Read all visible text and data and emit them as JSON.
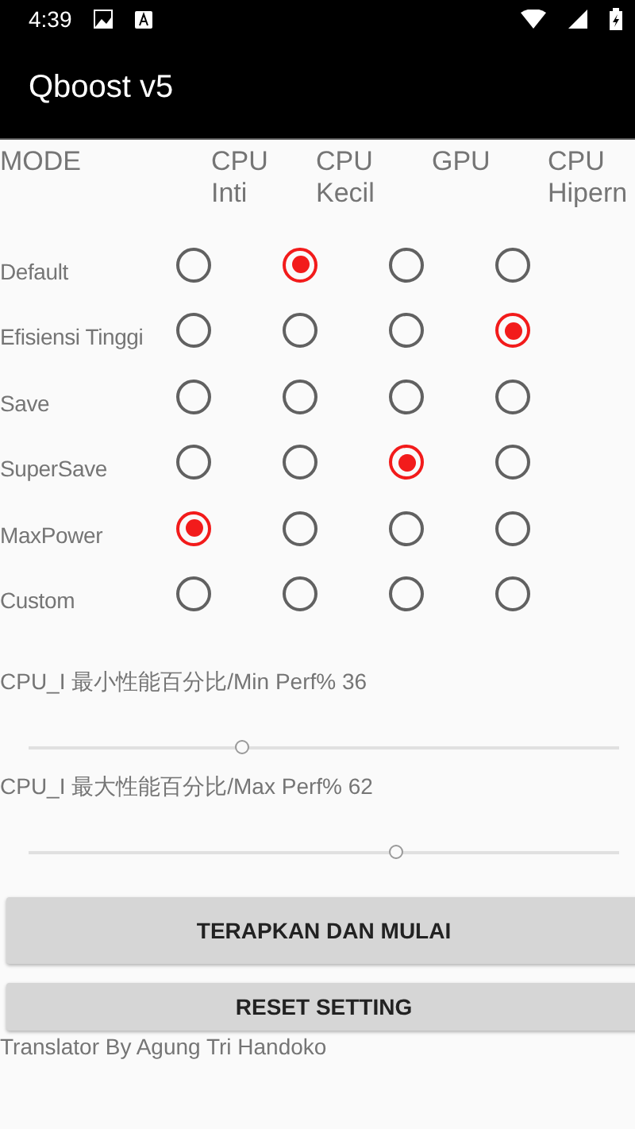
{
  "status_bar": {
    "time": "4:39"
  },
  "app_bar": {
    "title": "Qboost v5"
  },
  "table": {
    "mode_header": "MODE",
    "columns": [
      "CPU Inti",
      "CPU Kecil",
      "GPU",
      "CPU Hipern"
    ],
    "rows": [
      {
        "label": "Default",
        "options": [
          {
            "selected": false
          },
          {
            "selected": true
          },
          {
            "selected": false
          },
          {
            "selected": false
          }
        ]
      },
      {
        "label": "Efisiensi Tinggi",
        "options": [
          {
            "selected": false
          },
          {
            "selected": false
          },
          {
            "selected": false
          },
          {
            "selected": true
          }
        ]
      },
      {
        "label": "Save",
        "options": [
          {
            "selected": false
          },
          {
            "selected": false
          },
          {
            "selected": false
          },
          {
            "selected": false
          }
        ]
      },
      {
        "label": "SuperSave",
        "options": [
          {
            "selected": false
          },
          {
            "selected": false
          },
          {
            "selected": true
          },
          {
            "selected": false
          }
        ]
      },
      {
        "label": "MaxPower",
        "options": [
          {
            "selected": true
          },
          {
            "selected": false
          },
          {
            "selected": false
          },
          {
            "selected": false
          }
        ]
      },
      {
        "label": "Custom",
        "options": [
          {
            "selected": false
          },
          {
            "selected": false
          },
          {
            "selected": false
          },
          {
            "selected": false
          }
        ]
      }
    ]
  },
  "sliders": [
    {
      "label": "CPU_I 最小性能百分比/Min Perf% 36",
      "level": 0.36
    },
    {
      "label": "CPU_I 最大性能百分比/Max Perf% 62",
      "level": 0.62
    }
  ],
  "buttons": [
    "TERAPKAN DAN MULAI",
    "RESET SETTING"
  ],
  "footer": "Translator By Agung Tri Handoko"
}
